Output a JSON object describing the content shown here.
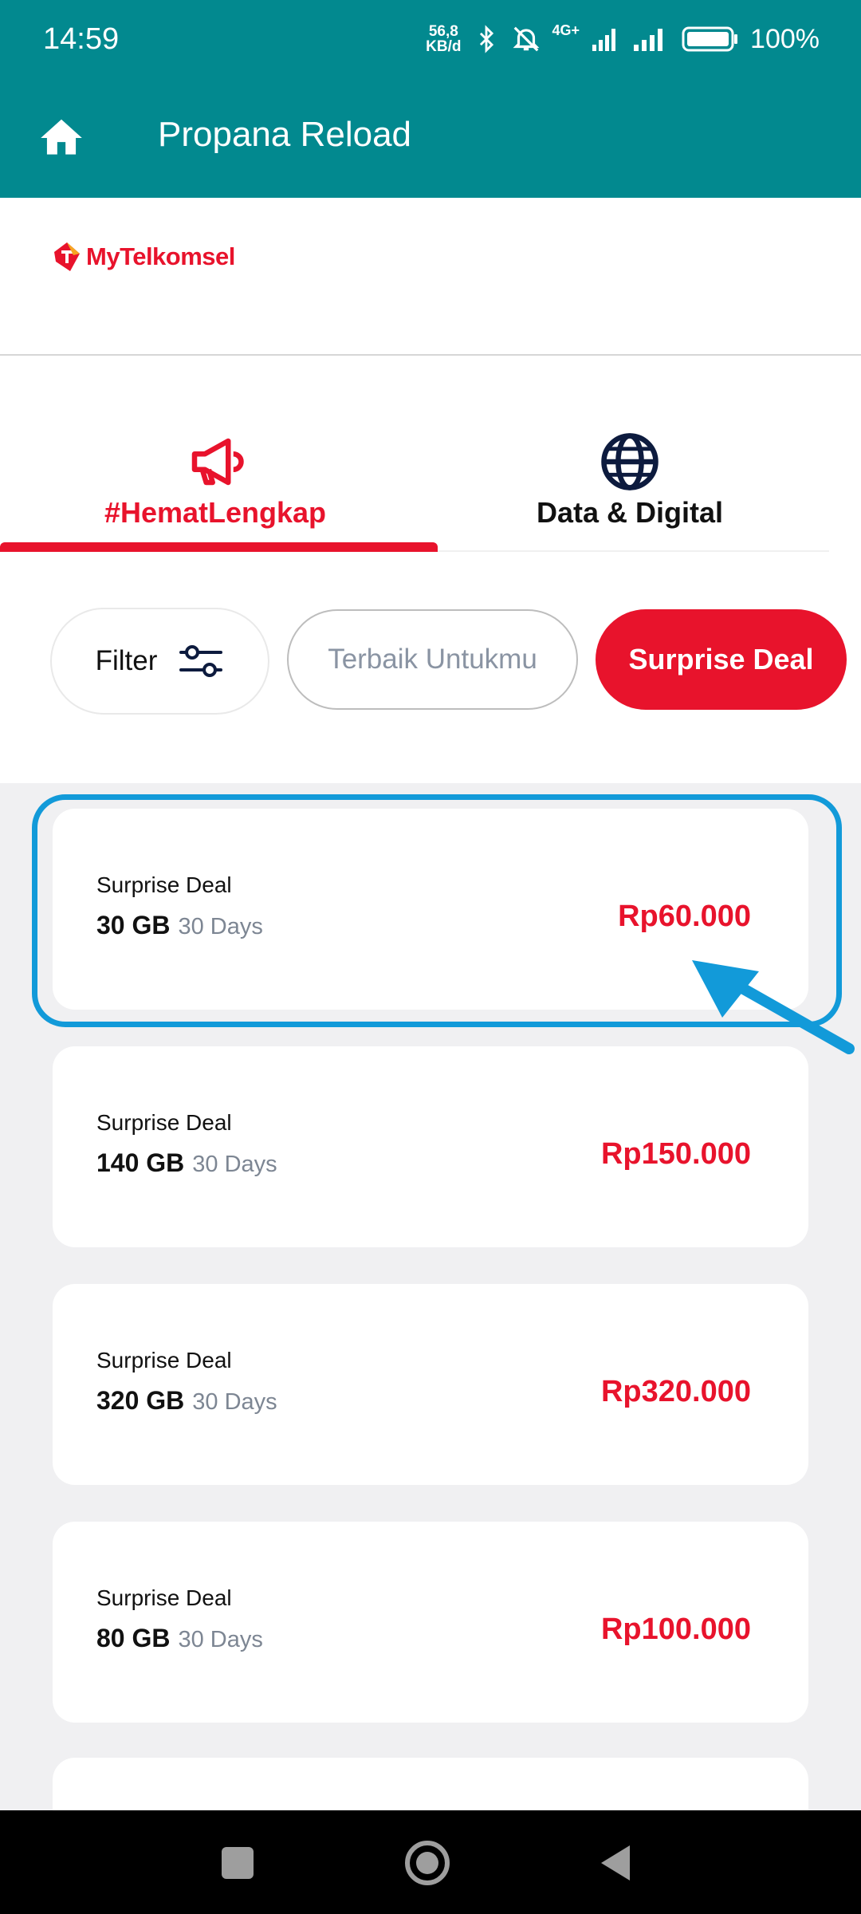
{
  "status_bar": {
    "time": "14:59",
    "net_speed_value": "56,8",
    "net_speed_unit": "KB/d",
    "network_type": "4G+",
    "battery": "100%"
  },
  "app_bar": {
    "title": "Propana Reload"
  },
  "brand": {
    "logo_text": "MyTelkomsel"
  },
  "tabs": [
    {
      "label": "#HematLengkap",
      "icon": "megaphone-icon",
      "active": true
    },
    {
      "label": "Data & Digital",
      "icon": "globe-icon",
      "active": false
    }
  ],
  "chips": {
    "filter_label": "Filter",
    "best_for_you": "Terbaik Untukmu",
    "surprise_deal": "Surprise Deal"
  },
  "offers": [
    {
      "title": "Surprise Deal",
      "quota": "30 GB",
      "validity": "30 Days",
      "price": "Rp60.000"
    },
    {
      "title": "Surprise Deal",
      "quota": "140 GB",
      "validity": "30 Days",
      "price": "Rp150.000"
    },
    {
      "title": "Surprise Deal",
      "quota": "320 GB",
      "validity": "30 Days",
      "price": "Rp320.000"
    },
    {
      "title": "Surprise Deal",
      "quota": "80 GB",
      "validity": "30 Days",
      "price": "Rp100.000"
    }
  ],
  "colors": {
    "header": "#02898f",
    "accent_red": "#e8132c",
    "highlight_blue": "#129ad9",
    "list_background": "#f0f0f2"
  }
}
